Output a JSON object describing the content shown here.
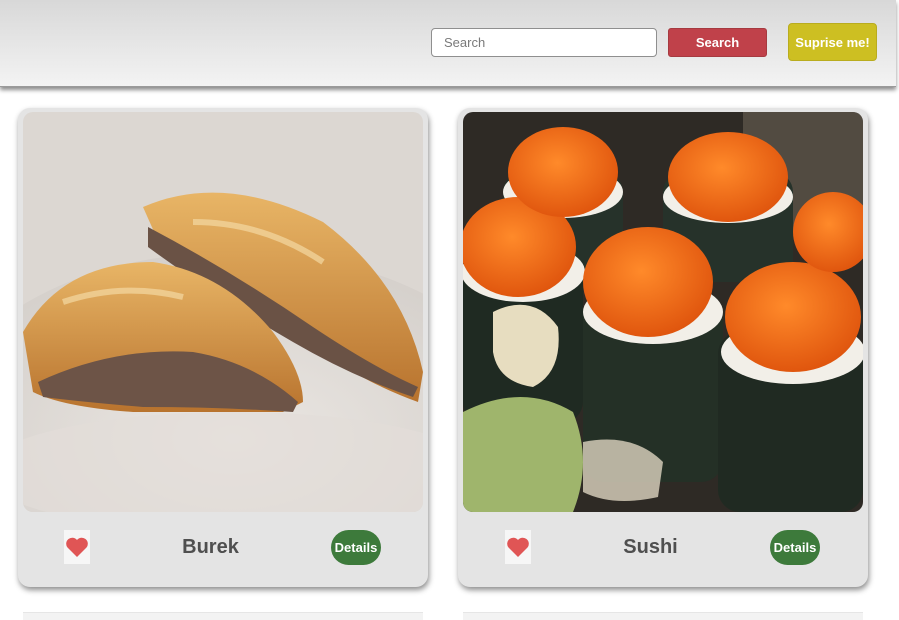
{
  "header": {
    "search_placeholder": "Search",
    "search_value": "",
    "search_label": "Search",
    "surprise_label": "Suprise me!"
  },
  "colors": {
    "search_button": "#c0414a",
    "surprise_button": "#cdbf22",
    "details_button": "#3d7a3b",
    "heart": "#e05555"
  },
  "cards": [
    {
      "title": "Burek",
      "details_label": "Details",
      "favorite_icon": "heart-icon",
      "photo": "burek-photo"
    },
    {
      "title": "Sushi",
      "details_label": "Details",
      "favorite_icon": "heart-icon",
      "photo": "sushi-photo"
    }
  ]
}
